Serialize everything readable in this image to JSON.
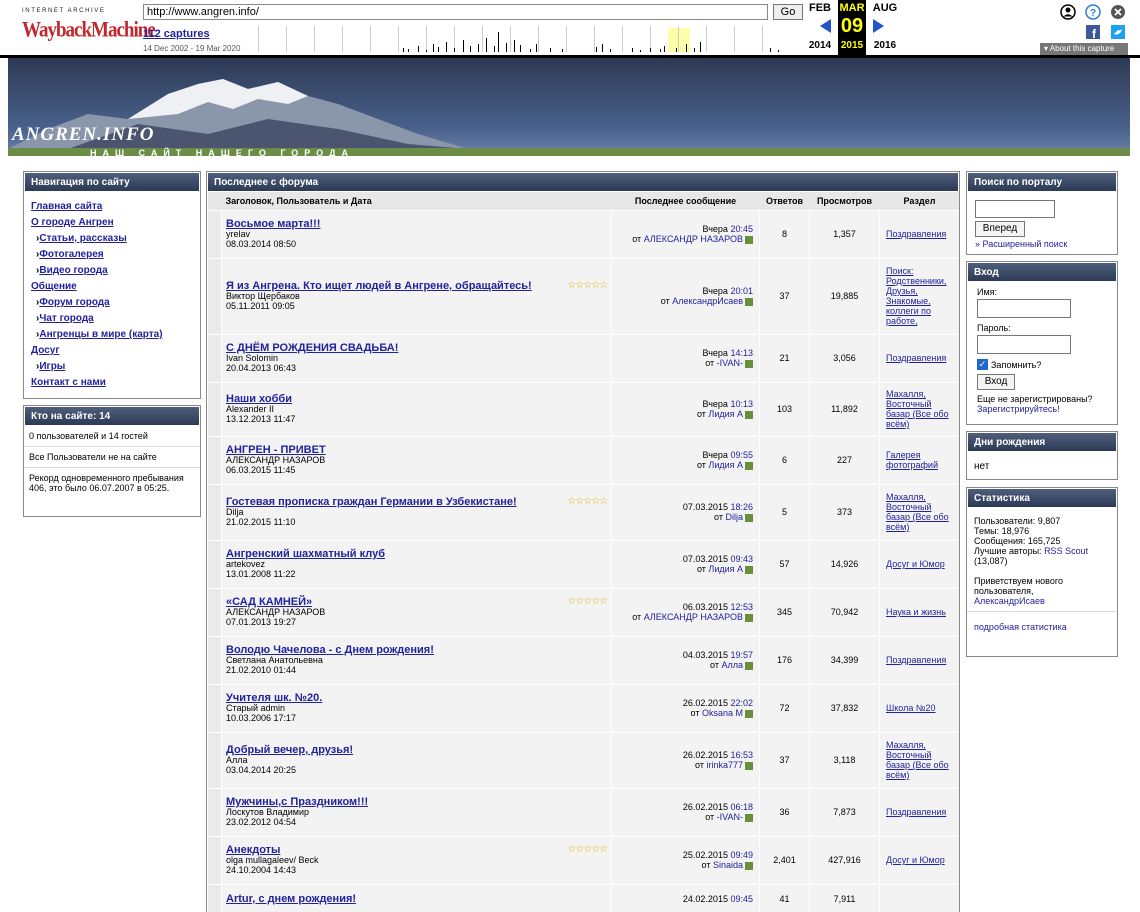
{
  "wayback": {
    "brand_top": "INTERNET ARCHIVE",
    "brand_logo": "WaybackMachine",
    "url": "http://www.angren.info/",
    "go_label": "Go",
    "captures": "112 captures",
    "range": "14 Dec 2002 - 19 Mar 2020",
    "months": {
      "prev": "FEB",
      "cur": "MAR",
      "next": "AUG"
    },
    "day": "09",
    "years": {
      "prev": "2014",
      "cur": "2015",
      "next": "2016"
    },
    "about": "▾ About this capture",
    "icons": [
      "user-icon",
      "help-icon",
      "close-icon",
      "facebook-icon",
      "twitter-icon"
    ]
  },
  "banner": {
    "title": "ANGREN.INFO",
    "subtitle": "НАШ САЙТ НАШЕГО ГОРОДА"
  },
  "nav": {
    "header": "Навигация по сайту",
    "items": [
      {
        "label": "Главная сайта",
        "sub": false
      },
      {
        "label": "О городе Ангрен",
        "sub": false
      },
      {
        "label": "Статьи, рассказы",
        "sub": true
      },
      {
        "label": "Фотогалерея",
        "sub": true
      },
      {
        "label": "Видео города",
        "sub": true
      },
      {
        "label": "Общение",
        "sub": false
      },
      {
        "label": "Форум города",
        "sub": true
      },
      {
        "label": "Чат города",
        "sub": true
      },
      {
        "label": "Ангренцы в мире (карта)",
        "sub": true
      },
      {
        "label": "Досуг",
        "sub": false
      },
      {
        "label": "Игры",
        "sub": true
      },
      {
        "label": "Контакт с нами",
        "sub": false
      }
    ]
  },
  "online": {
    "header": "Кто на сайте: 14",
    "line1": "0 пользователей и 14 гостей",
    "line2": "Все Пользователи не на сайте",
    "line3": "Рекорд одновременного пребывания 406, это было 06.07.2007 в 05:25."
  },
  "forum": {
    "header": "Последнее с форума",
    "columns": {
      "title": "Заголовок, Пользователь и Дата",
      "last": "Последнее сообщение",
      "replies": "Ответов",
      "views": "Просмотров",
      "section": "Раздел"
    },
    "rows": [
      {
        "title": "Восьмое марта!!!",
        "user": "yrelav",
        "date": "08.03.2014 08:50",
        "stars": false,
        "last_day": "Вчера",
        "last_time": "20:45",
        "last_by": "АЛЕКСАНДР НАЗАРОВ",
        "replies": "8",
        "views": "1,357",
        "section": "Поздравления"
      },
      {
        "title": "Я из Ангрена. Кто ищет людей в Ангрене, обращайтесь!",
        "user": "Виктор Щербаков",
        "date": "05.11.2011 09:05",
        "stars": true,
        "last_day": "Вчера",
        "last_time": "20:01",
        "last_by": "АлександрИсаев",
        "replies": "37",
        "views": "19,885",
        "section": "Поиск: Родственники, Друзья, Знакомые, коллеги по работе,"
      },
      {
        "title": "С ДНЁМ РОЖДЕНИЯ СВАДЬБА!",
        "user": "Ivan Solomin",
        "date": "20.04.2013 06:43",
        "stars": false,
        "last_day": "Вчера",
        "last_time": "14:13",
        "last_by": "-IVAN-",
        "replies": "21",
        "views": "3,056",
        "section": "Поздравления"
      },
      {
        "title": "Наши хобби",
        "user": "Alexander II",
        "date": "13.12.2013 11:47",
        "stars": false,
        "last_day": "Вчера",
        "last_time": "10:13",
        "last_by": "Лидия А",
        "replies": "103",
        "views": "11,892",
        "section": "Махалля, Восточный базар (Все обо всём)"
      },
      {
        "title": "АНГРЕН - ПРИВЕТ",
        "user": "АЛЕКСАНДР НАЗАРОВ",
        "date": "06.03.2015 11:45",
        "stars": false,
        "last_day": "Вчера",
        "last_time": "09:55",
        "last_by": "Лидия А",
        "replies": "6",
        "views": "227",
        "section": "Галерея фотографий"
      },
      {
        "title": "Гостевая прописка граждан Германии в Узбекистане!",
        "user": "Dilja",
        "date": "21.02.2015 11:10",
        "stars": true,
        "last_day": "07.03.2015",
        "last_time": "18:26",
        "last_by": "Dilja",
        "replies": "5",
        "views": "373",
        "section": "Махалля, Восточный базар (Все обо всём)"
      },
      {
        "title": "Ангренский шахматный клуб",
        "user": "artekovez",
        "date": "13.01.2008 11:22",
        "stars": false,
        "last_day": "07.03.2015",
        "last_time": "09:43",
        "last_by": "Лидия А",
        "replies": "57",
        "views": "14,926",
        "section": "Досуг и Юмор"
      },
      {
        "title": "«САД КАМНЕЙ»",
        "user": "АЛЕКСАНДР НАЗАРОВ",
        "date": "07.01.2013 19:27",
        "stars": true,
        "last_day": "06.03.2015",
        "last_time": "12:53",
        "last_by": "АЛЕКСАНДР НАЗАРОВ",
        "replies": "345",
        "views": "70,942",
        "section": "Наука и жизнь"
      },
      {
        "title": "Володю Чачелова - с Днем рождения!",
        "user": "Светлана Анатольевна",
        "date": "21.02.2010 01:44",
        "stars": false,
        "last_day": "04.03.2015",
        "last_time": "19:57",
        "last_by": "Алла",
        "replies": "176",
        "views": "34,399",
        "section": "Поздравления"
      },
      {
        "title": "Учителя шк. №20.",
        "user": "Старый admin",
        "date": "10.03.2006 17:17",
        "stars": false,
        "last_day": "26.02.2015",
        "last_time": "22:02",
        "last_by": "Oksana M",
        "replies": "72",
        "views": "37,832",
        "section": "Школа №20"
      },
      {
        "title": "Добрый вечер, друзья!",
        "user": "Алла",
        "date": "03.04.2014 20:25",
        "stars": false,
        "last_day": "26.02.2015",
        "last_time": "16:53",
        "last_by": "irinka777",
        "replies": "37",
        "views": "3,118",
        "section": "Махалля, Восточный базар (Все обо всём)"
      },
      {
        "title": "Мужчины,с Праздником!!!",
        "user": "Лоскутов Владимир",
        "date": "23.02.2012 04:54",
        "stars": false,
        "last_day": "26.02.2015",
        "last_time": "06:18",
        "last_by": "-IVAN-",
        "replies": "36",
        "views": "7,873",
        "section": "Поздравления"
      },
      {
        "title": "Анекдоты",
        "user": "olga mullagaleev/ Beck",
        "date": "24.10.2004 14:43",
        "stars": true,
        "last_day": "25.02.2015",
        "last_time": "09:49",
        "last_by": "Sinaida",
        "replies": "2,401",
        "views": "427,916",
        "section": "Досуг и Юмор"
      },
      {
        "title": "Artur, с днем рождения!",
        "user": "",
        "date": "",
        "stars": false,
        "last_day": "24.02.2015",
        "last_time": "09:45",
        "last_by": "",
        "replies": "41",
        "views": "7,911",
        "section": ""
      }
    ]
  },
  "search": {
    "header": "Поиск по порталу",
    "button": "Вперед",
    "advanced": "Расширенный поиск"
  },
  "login": {
    "header": "Вход",
    "name_label": "Имя:",
    "pass_label": "Пароль:",
    "remember": "Запомнить?",
    "button": "Вход",
    "not_registered": "Еще не зарегистрированы?",
    "register": "Зарегистрируйтесь!"
  },
  "birthdays": {
    "header": "Дни рождения",
    "value": "нет"
  },
  "stats": {
    "header": "Статистика",
    "users": "Пользователи: 9,807",
    "topics": "Темы: 18,976",
    "posts": "Сообщения: 165,725",
    "best_label": "Лучшие авторы:",
    "best_user": "RSS Scout",
    "best_count": "(13,087)",
    "welcome": "Приветствуем нового пользователя,",
    "new_user": "АлександрИсаев",
    "detailed": "подробная статистика"
  }
}
